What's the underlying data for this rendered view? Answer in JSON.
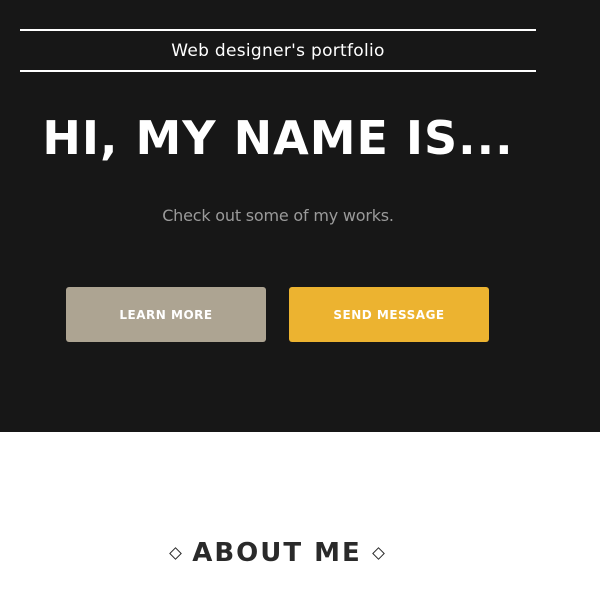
{
  "header": {
    "site_title": "Web designer's portfolio"
  },
  "hero": {
    "heading": "HI, MY NAME IS...",
    "subtitle": "Check out some of my works.",
    "buttons": {
      "learn_more": "LEARN MORE",
      "send_message": "SEND MESSAGE"
    }
  },
  "about": {
    "heading": "ABOUT ME"
  },
  "colors": {
    "hero_background": "#171717",
    "learn_more_button": "#ada492",
    "send_message_button": "#ecb330",
    "subtitle_text": "#9a9a9a"
  },
  "icons": [
    "diamond-icon",
    "diamond-icon"
  ]
}
